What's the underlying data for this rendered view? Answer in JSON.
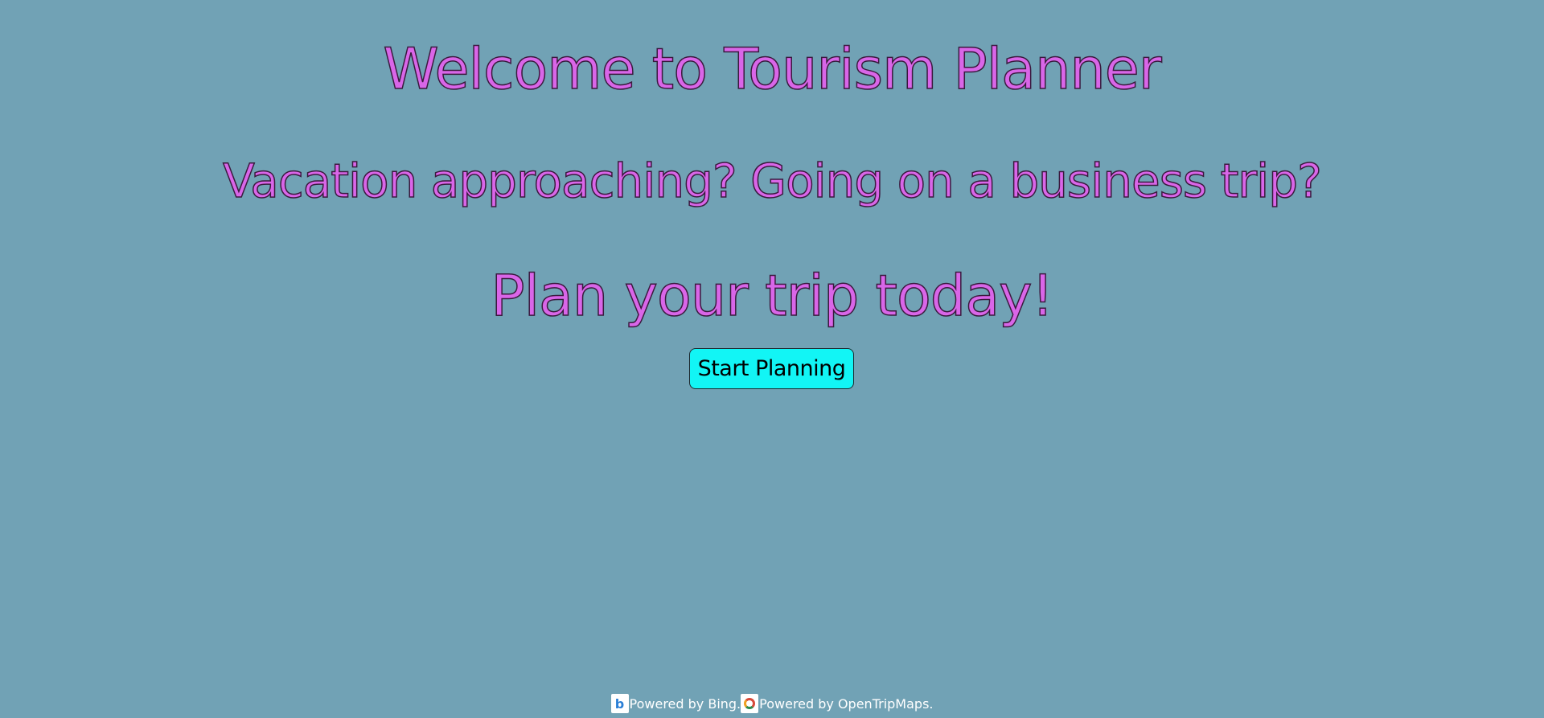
{
  "page": {
    "background_color": "#71a2b5",
    "heading_color": "#d966e8"
  },
  "hero": {
    "title": "Welcome to Tourism Planner",
    "subtitle": "Vacation approaching? Going on a business trip?",
    "cta_heading": "Plan your trip today!",
    "start_button_label": "Start Planning",
    "start_button_color": "#12f5f5"
  },
  "footer": {
    "bing_logo_icon": "bing-logo-icon",
    "bing_text": "Powered by Bing.",
    "opentripmap_logo_icon": "opentripmap-logo-icon",
    "opentripmap_text": "Powered by OpenTripMaps."
  }
}
